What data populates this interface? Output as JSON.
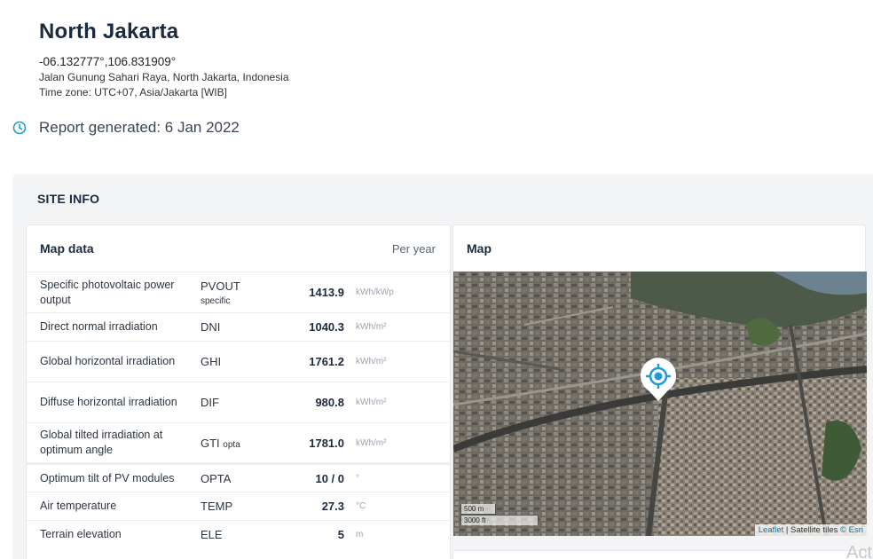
{
  "location": {
    "title": "North Jakarta",
    "coordinates": "-06.132777°,106.831909°",
    "address": "Jalan Gunung Sahari Raya, North Jakarta, Indonesia",
    "timezone": "Time zone: UTC+07, Asia/Jakarta [WIB]"
  },
  "report": {
    "text": "Report generated: 6 Jan 2022",
    "icon": "clock-icon",
    "icon_color": "#1f9ad6"
  },
  "site_info": {
    "title": "SITE INFO",
    "map_data": {
      "title": "Map data",
      "period": "Per year",
      "rows": [
        {
          "label": "Specific photovoltaic power output",
          "code": "PVOUT",
          "code_sub": "specific",
          "value": "1413.9",
          "unit": "kWh/kWp"
        },
        {
          "label": "Direct normal irradiation",
          "code": "DNI",
          "code_sub": "",
          "value": "1040.3",
          "unit": "kWh/m²"
        },
        {
          "label": "Global horizontal irradiation",
          "code": "GHI",
          "code_sub": "",
          "value": "1761.2",
          "unit": "kWh/m²"
        },
        {
          "label": "Diffuse horizontal irradiation",
          "code": "DIF",
          "code_sub": "",
          "value": "980.8",
          "unit": "kWh/m²"
        },
        {
          "label": "Global tilted irradiation at optimum angle",
          "code": "GTI",
          "code_sub": "opta",
          "value": "1781.0",
          "unit": "kWh/m²"
        },
        {
          "label": "Optimum tilt of PV modules",
          "code": "OPTA",
          "code_sub": "",
          "value": "10 / 0",
          "unit": "°"
        },
        {
          "label": "Air temperature",
          "code": "TEMP",
          "code_sub": "",
          "value": "27.3",
          "unit": "°C"
        },
        {
          "label": "Terrain elevation",
          "code": "ELE",
          "code_sub": "",
          "value": "5",
          "unit": "m"
        }
      ]
    },
    "map": {
      "title": "Map",
      "scale_metric": "500 m",
      "scale_imperial": "3000 ft",
      "attribution_leaflet": "Leaflet",
      "attribution_sep": " | Satellite tiles ",
      "attribution_esri": "© Esri",
      "marker_icon": "location-target-icon",
      "marker_color": "#1f9ad6"
    }
  },
  "watermark": "Act"
}
